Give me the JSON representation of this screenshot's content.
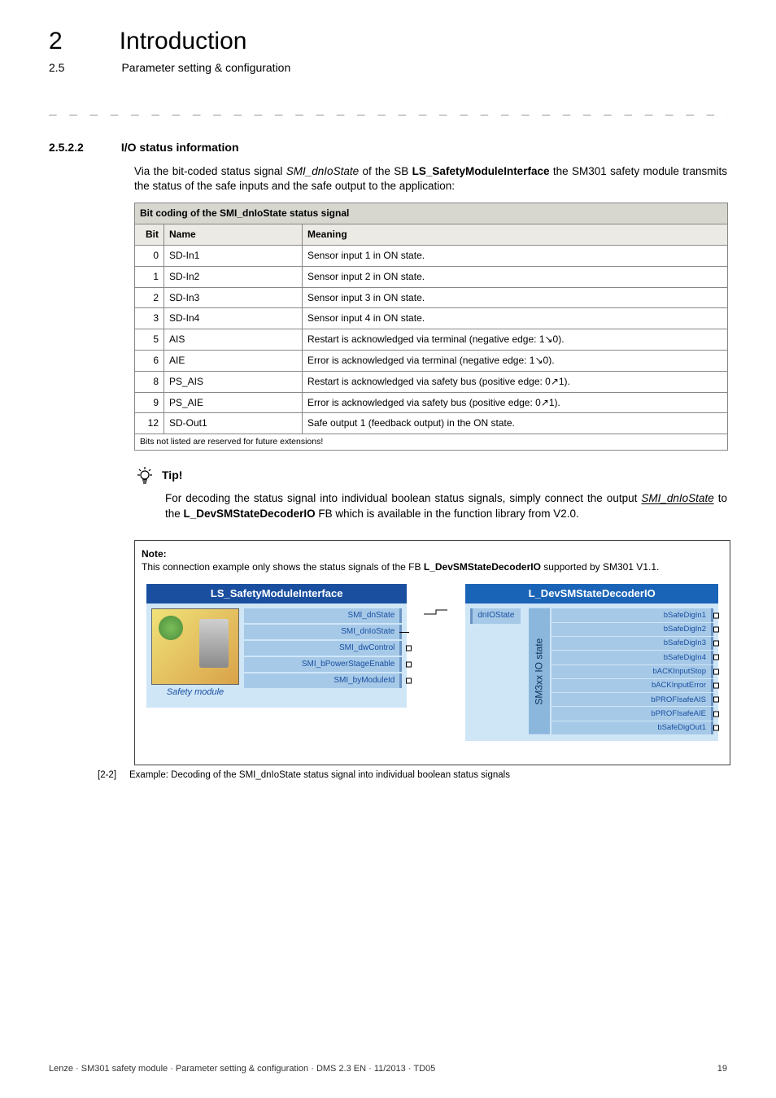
{
  "chapter": {
    "num": "2",
    "title": "Introduction"
  },
  "section": {
    "num": "2.5",
    "title": "Parameter setting & configuration"
  },
  "dashes": "_ _ _ _ _ _ _ _ _ _ _ _ _ _ _ _ _ _ _ _ _ _ _ _ _ _ _ _ _ _ _ _ _ _ _ _ _ _ _ _ _ _ _ _ _ _ _ _ _ _ _ _ _ _ _ _ _ _ _ _ _ _ _ _",
  "subsection": {
    "num": "2.5.2.2",
    "title": "I/O status information"
  },
  "intro_before_italic": "Via the bit-coded status signal ",
  "intro_italic": "SMI_dnIoState",
  "intro_mid": " of the SB ",
  "intro_bold1": "LS_SafetyModuleInterface",
  "intro_after": " the SM301 safety module transmits the status of the safe inputs and the safe output to the application:",
  "table": {
    "caption": "Bit coding of the SMI_dnIoState status signal",
    "headers": {
      "bit": "Bit",
      "name": "Name",
      "meaning": "Meaning"
    },
    "rows": [
      {
        "bit": "0",
        "name": "SD-In1",
        "meaning": "Sensor input 1 in ON state."
      },
      {
        "bit": "1",
        "name": "SD-In2",
        "meaning": "Sensor input 2 in ON state."
      },
      {
        "bit": "2",
        "name": "SD-In3",
        "meaning": "Sensor input 3 in ON state."
      },
      {
        "bit": "3",
        "name": "SD-In4",
        "meaning": "Sensor input 4 in ON state."
      },
      {
        "bit": "5",
        "name": "AIS",
        "meaning": "Restart is acknowledged via terminal (negative edge: 1↘0)."
      },
      {
        "bit": "6",
        "name": "AIE",
        "meaning": "Error is acknowledged via terminal (negative edge: 1↘0)."
      },
      {
        "bit": "8",
        "name": "PS_AIS",
        "meaning": "Restart is acknowledged via safety bus (positive edge: 0↗1)."
      },
      {
        "bit": "9",
        "name": "PS_AIE",
        "meaning": "Error is acknowledged via safety bus (positive edge: 0↗1)."
      },
      {
        "bit": "12",
        "name": "SD-Out1",
        "meaning": "Safe output 1 (feedback output) in the ON state."
      }
    ],
    "footnote": "Bits not listed are reserved for future extensions!"
  },
  "tip": {
    "label": "Tip!",
    "body_pre": "For decoding the status signal into individual boolean status signals, simply connect the output ",
    "body_italic": "SMI_dnIoState",
    "body_mid": " to the ",
    "body_bold": "L_DevSMStateDecoderIO",
    "body_post": " FB which is available in the function library from V2.0."
  },
  "note": {
    "head": "Note:",
    "body_pre": "This connection example only shows the status signals of the FB ",
    "body_bold": "L_DevSMStateDecoderIO",
    "body_post": " supported by SM301 V1.1."
  },
  "diagram": {
    "left_title": "LS_SafetyModuleInterface",
    "right_title": "L_DevSMStateDecoderIO",
    "module_label": "Safety module",
    "left_ports": [
      "SMI_dnState",
      "SMI_dnIoState",
      "SMI_dwControl",
      "SMI_bPowerStageEnable",
      "SMI_byModuleId"
    ],
    "in_port": "dnIOState",
    "core": "SM3xx IO state",
    "out_ports": [
      "bSafeDigIn1",
      "bSafeDigIn2",
      "bSafeDigIn3",
      "bSafeDigIn4",
      "bACKInputStop",
      "bACKInputError",
      "bPROFIsafeAIS",
      "bPROFIsafeAIE",
      "bSafeDigOut1"
    ]
  },
  "figure": {
    "ref": "[2-2]",
    "caption": "Example: Decoding of the SMI_dnIoState status signal into individual boolean status signals"
  },
  "footer": {
    "left": "Lenze · SM301 safety module · Parameter setting & configuration · DMS 2.3 EN · 11/2013 · TD05",
    "right": "19"
  }
}
